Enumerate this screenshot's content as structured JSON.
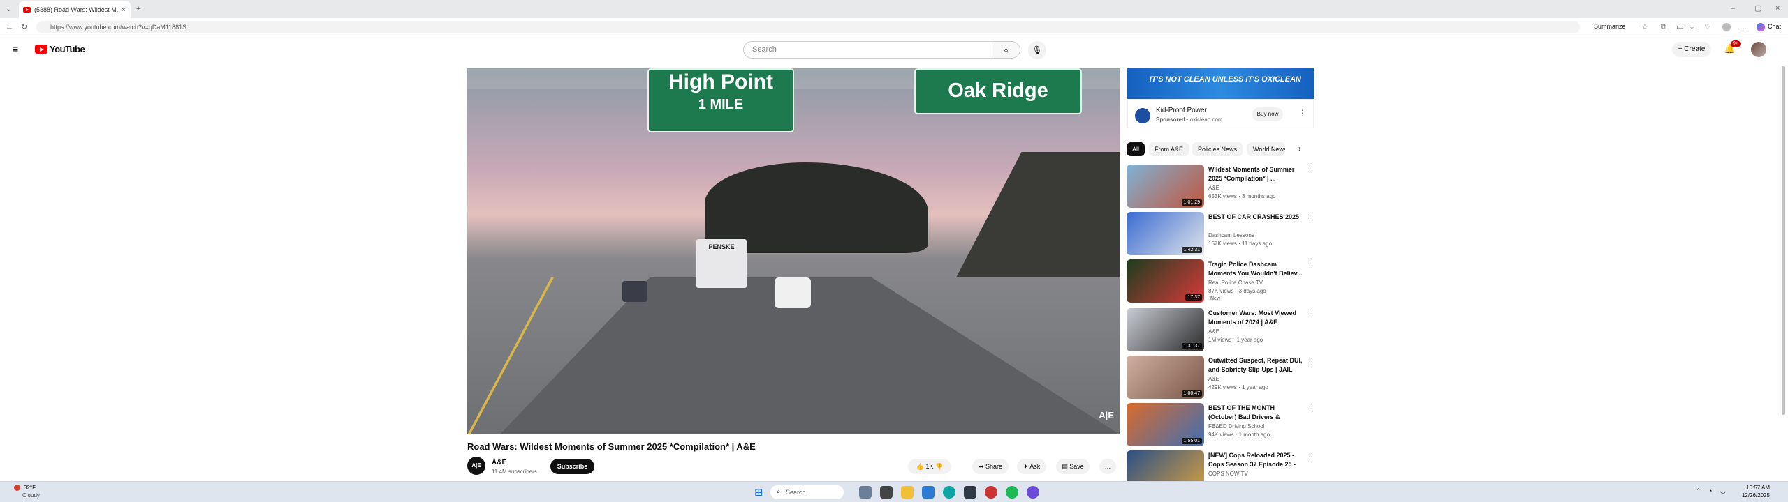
{
  "browser": {
    "tab_title": "(5388) Road Wars: Wildest M...",
    "url": "https://www.youtube.com/watch?v=qDaM11881S",
    "summarize": "Summarize",
    "chat": "Chat"
  },
  "header": {
    "logo": "YouTube",
    "search_placeholder": "Search",
    "create": "Create",
    "notifications": "9+"
  },
  "video": {
    "sign_left_1": "High Point",
    "sign_left_2": "1 MILE",
    "sign_right": "Oak Ridge",
    "truck_text": "PENSKE",
    "watermark": "A|E",
    "title": "Road Wars: Wildest Moments of Summer 2025 *Compilation* | A&E",
    "channel": "A&E",
    "subscribers": "11.4M subscribers",
    "subscribe": "Subscribe",
    "likes": "1K",
    "share": "Share",
    "ask": "Ask",
    "save": "Save"
  },
  "ad": {
    "banner": "IT'S NOT CLEAN UNLESS IT'S OXICLEAN",
    "name": "Kid-Proof Power",
    "sponsored": "Sponsored",
    "domain": "oxiclean.com",
    "buy": "Buy now"
  },
  "chips": [
    "All",
    "From A&E",
    "Policies News",
    "World News"
  ],
  "recommendations": [
    {
      "title": "Wildest Moments of Summer 2025 *Compilation* | ...",
      "channel": "A&E",
      "meta": "653K views · 3 months ago",
      "duration": "1:01:29",
      "color1": "#7fb3d6",
      "color2": "#c2553d"
    },
    {
      "title": "BEST OF CAR CRASHES 2025",
      "channel": "Dashcam Lessons",
      "meta": "157K views · 11 days ago",
      "duration": "1:42:31",
      "color1": "#3a6bd1",
      "color2": "#e0e4ea"
    },
    {
      "title": "Tragic Police Dashcam Moments You Wouldn't Believ...",
      "channel": "Real Police Chase TV",
      "meta": "87K views · 3 days ago",
      "duration": "17:37",
      "badge": "New",
      "color1": "#1c3d1f",
      "color2": "#d83a3a"
    },
    {
      "title": "Customer Wars: Most Viewed Moments of 2024 | A&E",
      "channel": "A&E",
      "meta": "1M views · 1 year ago",
      "duration": "1:31:37",
      "color1": "#c9cdd4",
      "color2": "#2b2b2b"
    },
    {
      "title": "Outwitted Suspect, Repeat DUI, and Sobriety Slip-Ups | JAIL 1...",
      "channel": "A&E",
      "meta": "429K views · 1 year ago",
      "duration": "1:00:47",
      "color1": "#d0b0a0",
      "color2": "#7a5545"
    },
    {
      "title": "BEST OF THE MONTH (October) Bad Drivers & Brake...",
      "channel": "FB&ED Driving School",
      "meta": "94K views · 1 month ago",
      "duration": "1:55:01",
      "color1": "#d96b2b",
      "color2": "#3f6fb5"
    },
    {
      "title": "[NEW] Cops Reloaded 2025 - Cops Season 37 Episode 25 - ...",
      "channel": "COPS NOW TV",
      "meta": "",
      "duration": "",
      "color1": "#2a4f86",
      "color2": "#d6a040"
    }
  ],
  "taskbar": {
    "temp": "32°F",
    "weather": "Cloudy",
    "search": "Search",
    "time": "10:57 AM",
    "date": "12/26/2025"
  }
}
